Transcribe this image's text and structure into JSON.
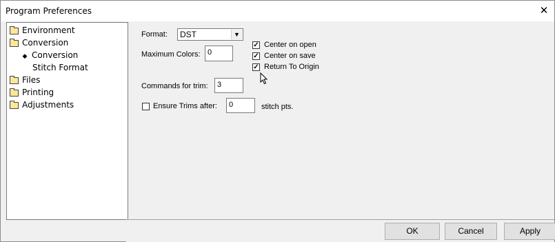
{
  "window": {
    "title": "Program Preferences",
    "close_label": "✕"
  },
  "tree": {
    "items": [
      {
        "label": "Environment",
        "icon": "folder-icon"
      },
      {
        "label": "Conversion",
        "icon": "folder-open-icon"
      },
      {
        "label": "Conversion",
        "icon": "bullet-icon"
      },
      {
        "label": "Stitch Format"
      },
      {
        "label": "Files",
        "icon": "folder-icon"
      },
      {
        "label": "Printing",
        "icon": "folder-icon"
      },
      {
        "label": "Adjustments",
        "icon": "folder-icon"
      }
    ]
  },
  "form": {
    "format_label": "Format:",
    "format_value": "DST",
    "max_colors_label": "Maximum Colors:",
    "max_colors_value": "0",
    "commands_trim_label": "Commands for trim:",
    "commands_trim_value": "3",
    "ensure_trims_label": "Ensure Trims after:",
    "ensure_trims_value": "0",
    "ensure_trims_checked": false,
    "stitch_pts_label": "stitch pts.",
    "center_on_open_label": "Center on open",
    "center_on_open_checked": true,
    "center_on_save_label": "Center on save",
    "center_on_save_checked": true,
    "return_origin_label": "Return To Origin",
    "return_origin_checked": true
  },
  "buttons": {
    "ok": "OK",
    "cancel": "Cancel",
    "apply": "Apply"
  }
}
